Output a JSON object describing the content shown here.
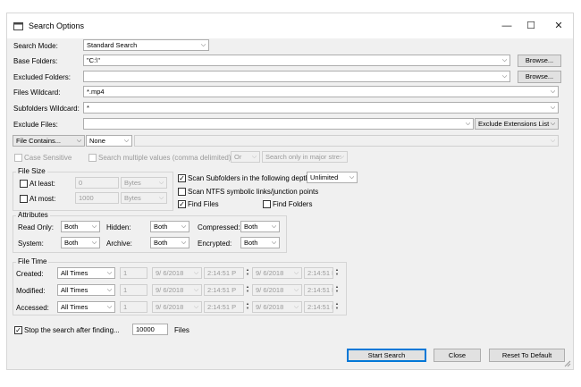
{
  "window": {
    "title": "Search Options",
    "minimize_glyph": "—",
    "maximize_glyph": "☐",
    "close_glyph": "✕"
  },
  "form": {
    "search_mode": {
      "label": "Search Mode:",
      "value": "Standard Search"
    },
    "base_folders": {
      "label": "Base Folders:",
      "value": "\"C:\\\"",
      "browse": "Browse..."
    },
    "excluded_folders": {
      "label": "Excluded Folders:",
      "value": "",
      "browse": "Browse..."
    },
    "files_wildcard": {
      "label": "Files Wildcard:",
      "value": "*.mp4"
    },
    "subfolders_wildcard": {
      "label": "Subfolders Wildcard:",
      "value": "*"
    },
    "exclude_files": {
      "label": "Exclude Files:",
      "value": "",
      "list_button": "Exclude Extensions List"
    },
    "file_contains": {
      "mode": "File Contains...",
      "type": "None",
      "value": ""
    },
    "case_sensitive": {
      "label": "Case Sensitive",
      "checked": false
    },
    "search_multiple": {
      "label": "Search multiple values (comma delimited)",
      "checked": false,
      "operator": "Or",
      "stream": "Search only in major stre:"
    }
  },
  "file_size": {
    "title": "File Size",
    "at_least": {
      "label": "At least:",
      "value": "0",
      "unit": "Bytes",
      "checked": false
    },
    "at_most": {
      "label": "At most:",
      "value": "1000",
      "unit": "Bytes",
      "checked": false
    }
  },
  "options": {
    "scan_subfolders": {
      "label": "Scan Subfolders in the following depth:",
      "checked": true,
      "depth": "Unlimited"
    },
    "scan_ntfs": {
      "label": "Scan NTFS symbolic links/junction points",
      "checked": false
    },
    "find_files": {
      "label": "Find Files",
      "checked": true
    },
    "find_folders": {
      "label": "Find Folders",
      "checked": false
    }
  },
  "attributes": {
    "title": "Attributes",
    "read_only": {
      "label": "Read Only:",
      "value": "Both"
    },
    "hidden": {
      "label": "Hidden:",
      "value": "Both"
    },
    "compressed": {
      "label": "Compressed:",
      "value": "Both"
    },
    "system": {
      "label": "System:",
      "value": "Both"
    },
    "archive": {
      "label": "Archive:",
      "value": "Both"
    },
    "encrypted": {
      "label": "Encrypted:",
      "value": "Both"
    }
  },
  "file_time": {
    "title": "File Time",
    "rows": [
      {
        "label": "Created:",
        "mode": "All Times",
        "count": "1",
        "date1": "9/ 6/2018",
        "time1": "2:14:51 P",
        "date2": "9/ 6/2018",
        "time2": "2:14:51 P"
      },
      {
        "label": "Modified:",
        "mode": "All Times",
        "count": "1",
        "date1": "9/ 6/2018",
        "time1": "2:14:51 P",
        "date2": "9/ 6/2018",
        "time2": "2:14:51 P"
      },
      {
        "label": "Accessed:",
        "mode": "All Times",
        "count": "1",
        "date1": "9/ 6/2018",
        "time1": "2:14:51 P",
        "date2": "9/ 6/2018",
        "time2": "2:14:51 P"
      }
    ]
  },
  "stop": {
    "label": "Stop the search after finding...",
    "checked": true,
    "value": "10000",
    "suffix": "Files"
  },
  "buttons": {
    "start": "Start Search",
    "close": "Close",
    "reset": "Reset To Default"
  }
}
